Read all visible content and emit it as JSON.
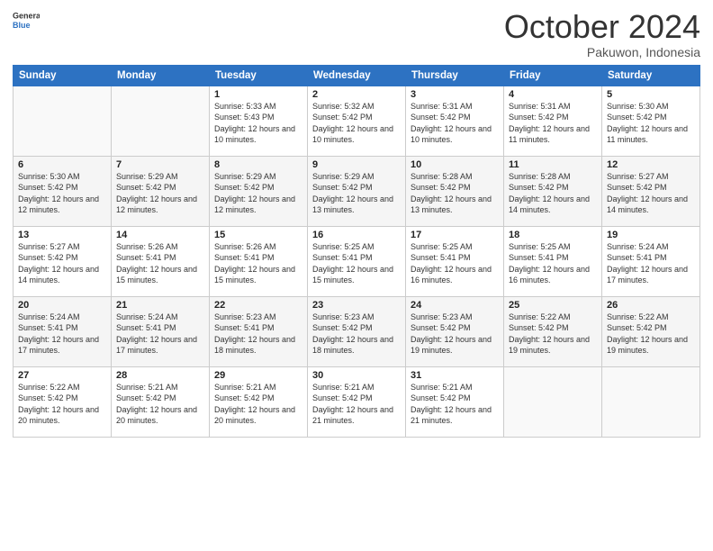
{
  "header": {
    "logo_line1": "General",
    "logo_line2": "Blue",
    "title": "October 2024",
    "location": "Pakuwon, Indonesia"
  },
  "weekdays": [
    "Sunday",
    "Monday",
    "Tuesday",
    "Wednesday",
    "Thursday",
    "Friday",
    "Saturday"
  ],
  "weeks": [
    [
      {
        "day": "",
        "sunrise": "",
        "sunset": "",
        "daylight": ""
      },
      {
        "day": "",
        "sunrise": "",
        "sunset": "",
        "daylight": ""
      },
      {
        "day": "1",
        "sunrise": "Sunrise: 5:33 AM",
        "sunset": "Sunset: 5:43 PM",
        "daylight": "Daylight: 12 hours and 10 minutes."
      },
      {
        "day": "2",
        "sunrise": "Sunrise: 5:32 AM",
        "sunset": "Sunset: 5:42 PM",
        "daylight": "Daylight: 12 hours and 10 minutes."
      },
      {
        "day": "3",
        "sunrise": "Sunrise: 5:31 AM",
        "sunset": "Sunset: 5:42 PM",
        "daylight": "Daylight: 12 hours and 10 minutes."
      },
      {
        "day": "4",
        "sunrise": "Sunrise: 5:31 AM",
        "sunset": "Sunset: 5:42 PM",
        "daylight": "Daylight: 12 hours and 11 minutes."
      },
      {
        "day": "5",
        "sunrise": "Sunrise: 5:30 AM",
        "sunset": "Sunset: 5:42 PM",
        "daylight": "Daylight: 12 hours and 11 minutes."
      }
    ],
    [
      {
        "day": "6",
        "sunrise": "Sunrise: 5:30 AM",
        "sunset": "Sunset: 5:42 PM",
        "daylight": "Daylight: 12 hours and 12 minutes."
      },
      {
        "day": "7",
        "sunrise": "Sunrise: 5:29 AM",
        "sunset": "Sunset: 5:42 PM",
        "daylight": "Daylight: 12 hours and 12 minutes."
      },
      {
        "day": "8",
        "sunrise": "Sunrise: 5:29 AM",
        "sunset": "Sunset: 5:42 PM",
        "daylight": "Daylight: 12 hours and 12 minutes."
      },
      {
        "day": "9",
        "sunrise": "Sunrise: 5:29 AM",
        "sunset": "Sunset: 5:42 PM",
        "daylight": "Daylight: 12 hours and 13 minutes."
      },
      {
        "day": "10",
        "sunrise": "Sunrise: 5:28 AM",
        "sunset": "Sunset: 5:42 PM",
        "daylight": "Daylight: 12 hours and 13 minutes."
      },
      {
        "day": "11",
        "sunrise": "Sunrise: 5:28 AM",
        "sunset": "Sunset: 5:42 PM",
        "daylight": "Daylight: 12 hours and 14 minutes."
      },
      {
        "day": "12",
        "sunrise": "Sunrise: 5:27 AM",
        "sunset": "Sunset: 5:42 PM",
        "daylight": "Daylight: 12 hours and 14 minutes."
      }
    ],
    [
      {
        "day": "13",
        "sunrise": "Sunrise: 5:27 AM",
        "sunset": "Sunset: 5:42 PM",
        "daylight": "Daylight: 12 hours and 14 minutes."
      },
      {
        "day": "14",
        "sunrise": "Sunrise: 5:26 AM",
        "sunset": "Sunset: 5:41 PM",
        "daylight": "Daylight: 12 hours and 15 minutes."
      },
      {
        "day": "15",
        "sunrise": "Sunrise: 5:26 AM",
        "sunset": "Sunset: 5:41 PM",
        "daylight": "Daylight: 12 hours and 15 minutes."
      },
      {
        "day": "16",
        "sunrise": "Sunrise: 5:25 AM",
        "sunset": "Sunset: 5:41 PM",
        "daylight": "Daylight: 12 hours and 15 minutes."
      },
      {
        "day": "17",
        "sunrise": "Sunrise: 5:25 AM",
        "sunset": "Sunset: 5:41 PM",
        "daylight": "Daylight: 12 hours and 16 minutes."
      },
      {
        "day": "18",
        "sunrise": "Sunrise: 5:25 AM",
        "sunset": "Sunset: 5:41 PM",
        "daylight": "Daylight: 12 hours and 16 minutes."
      },
      {
        "day": "19",
        "sunrise": "Sunrise: 5:24 AM",
        "sunset": "Sunset: 5:41 PM",
        "daylight": "Daylight: 12 hours and 17 minutes."
      }
    ],
    [
      {
        "day": "20",
        "sunrise": "Sunrise: 5:24 AM",
        "sunset": "Sunset: 5:41 PM",
        "daylight": "Daylight: 12 hours and 17 minutes."
      },
      {
        "day": "21",
        "sunrise": "Sunrise: 5:24 AM",
        "sunset": "Sunset: 5:41 PM",
        "daylight": "Daylight: 12 hours and 17 minutes."
      },
      {
        "day": "22",
        "sunrise": "Sunrise: 5:23 AM",
        "sunset": "Sunset: 5:41 PM",
        "daylight": "Daylight: 12 hours and 18 minutes."
      },
      {
        "day": "23",
        "sunrise": "Sunrise: 5:23 AM",
        "sunset": "Sunset: 5:42 PM",
        "daylight": "Daylight: 12 hours and 18 minutes."
      },
      {
        "day": "24",
        "sunrise": "Sunrise: 5:23 AM",
        "sunset": "Sunset: 5:42 PM",
        "daylight": "Daylight: 12 hours and 19 minutes."
      },
      {
        "day": "25",
        "sunrise": "Sunrise: 5:22 AM",
        "sunset": "Sunset: 5:42 PM",
        "daylight": "Daylight: 12 hours and 19 minutes."
      },
      {
        "day": "26",
        "sunrise": "Sunrise: 5:22 AM",
        "sunset": "Sunset: 5:42 PM",
        "daylight": "Daylight: 12 hours and 19 minutes."
      }
    ],
    [
      {
        "day": "27",
        "sunrise": "Sunrise: 5:22 AM",
        "sunset": "Sunset: 5:42 PM",
        "daylight": "Daylight: 12 hours and 20 minutes."
      },
      {
        "day": "28",
        "sunrise": "Sunrise: 5:21 AM",
        "sunset": "Sunset: 5:42 PM",
        "daylight": "Daylight: 12 hours and 20 minutes."
      },
      {
        "day": "29",
        "sunrise": "Sunrise: 5:21 AM",
        "sunset": "Sunset: 5:42 PM",
        "daylight": "Daylight: 12 hours and 20 minutes."
      },
      {
        "day": "30",
        "sunrise": "Sunrise: 5:21 AM",
        "sunset": "Sunset: 5:42 PM",
        "daylight": "Daylight: 12 hours and 21 minutes."
      },
      {
        "day": "31",
        "sunrise": "Sunrise: 5:21 AM",
        "sunset": "Sunset: 5:42 PM",
        "daylight": "Daylight: 12 hours and 21 minutes."
      },
      {
        "day": "",
        "sunrise": "",
        "sunset": "",
        "daylight": ""
      },
      {
        "day": "",
        "sunrise": "",
        "sunset": "",
        "daylight": ""
      }
    ]
  ]
}
